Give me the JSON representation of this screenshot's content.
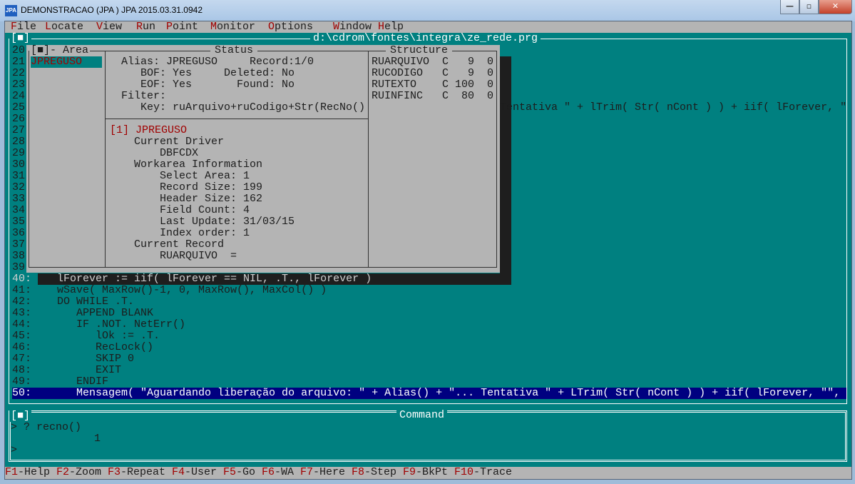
{
  "window": {
    "title": "DEMONSTRACAO (JPA ) JPA 2015.03.31.0942",
    "icon_text": "JPA",
    "minimize": "—",
    "maximize": "▫",
    "close": "✕"
  },
  "menu": [
    {
      "hotkey": "F",
      "rest": "ile"
    },
    {
      "hotkey": "L",
      "rest": "ocate"
    },
    {
      "hotkey": "V",
      "rest": "iew"
    },
    {
      "hotkey": "R",
      "rest": "un"
    },
    {
      "hotkey": "P",
      "rest": "oint"
    },
    {
      "hotkey": "M",
      "rest": "onitor"
    },
    {
      "hotkey": "O",
      "rest": "ptions"
    },
    {
      "hotkey": "W",
      "rest": "indow"
    },
    {
      "hotkey": "H",
      "rest": "elp"
    }
  ],
  "code_window": {
    "close_box": "[■]",
    "path": "d:\\cdrom\\fontes\\integra\\ze_rede.prg",
    "hidden_line_numbers": [
      "20",
      "21",
      "22",
      "23",
      "24",
      "25",
      "26",
      "27",
      "28",
      "29",
      "30",
      "31",
      "32",
      "33",
      "34",
      "35",
      "36",
      "37",
      "38",
      "39"
    ],
    "line25_tail": "Tentativa \" + lTrim( Str( nCont ) ) + iif( lForever, \"",
    "lines": [
      "40:    lForever := iif( lForever == NIL, .T., lForever )",
      "41:    wSave( MaxRow()-1, 0, MaxRow(), MaxCol() )",
      "42:    DO WHILE .T.",
      "43:       APPEND BLANK",
      "44:       IF .NOT. NetErr()",
      "45:          lOk := .T.",
      "46:          RecLock()",
      "47:          SKIP 0",
      "48:          EXIT",
      "49:       ENDIF",
      "50:       Mensagem( \"Aguardando liberação do arquivo: \" + Alias() + \"... Tentativa \" + LTrim( Str( nCont ) ) + iif( lForever, \"\","
    ]
  },
  "workarea": {
    "area_title": "[■]- Area",
    "status_title": "Status",
    "structure_title": "Structure",
    "areas": [
      "JPREGUSO"
    ],
    "status": [
      "  Alias: JPREGUSO     Record:1/0",
      "     BOF: Yes     Deleted: No",
      "     EOF: Yes       Found: No",
      "  Filter:",
      "     Key: ruArquivo+ruCodigo+Str(RecNo()"
    ],
    "info_header": "[1] JPREGUSO",
    "info": [
      "    Current Driver",
      "        DBFCDX",
      "    Workarea Information",
      "        Select Area: 1",
      "        Record Size: 199",
      "        Header Size: 162",
      "        Field Count: 4",
      "        Last Update: 31/03/15",
      "        Index order: 1",
      "    Current Record",
      "        RUARQUIVO  ="
    ],
    "structure": [
      "RUARQUIVO  C   9  0",
      "RUCODIGO   C   9  0",
      "RUTEXTO    C 100  0",
      "RUINFINC   C  80  0"
    ]
  },
  "command": {
    "close_box": "[■]",
    "title": "Command",
    "lines": [
      "> ? recno()",
      "             1",
      "> "
    ]
  },
  "fkeys": [
    {
      "key": "F1",
      "label": "-Help"
    },
    {
      "key": "F2",
      "label": "-Zoom"
    },
    {
      "key": "F3",
      "label": "-Repeat"
    },
    {
      "key": "F4",
      "label": "-User"
    },
    {
      "key": "F5",
      "label": "-Go"
    },
    {
      "key": "F6",
      "label": "-WA"
    },
    {
      "key": "F7",
      "label": "-Here"
    },
    {
      "key": "F8",
      "label": "-Step"
    },
    {
      "key": "F9",
      "label": "-BkPt"
    },
    {
      "key": "F10",
      "label": "-Trace"
    }
  ]
}
